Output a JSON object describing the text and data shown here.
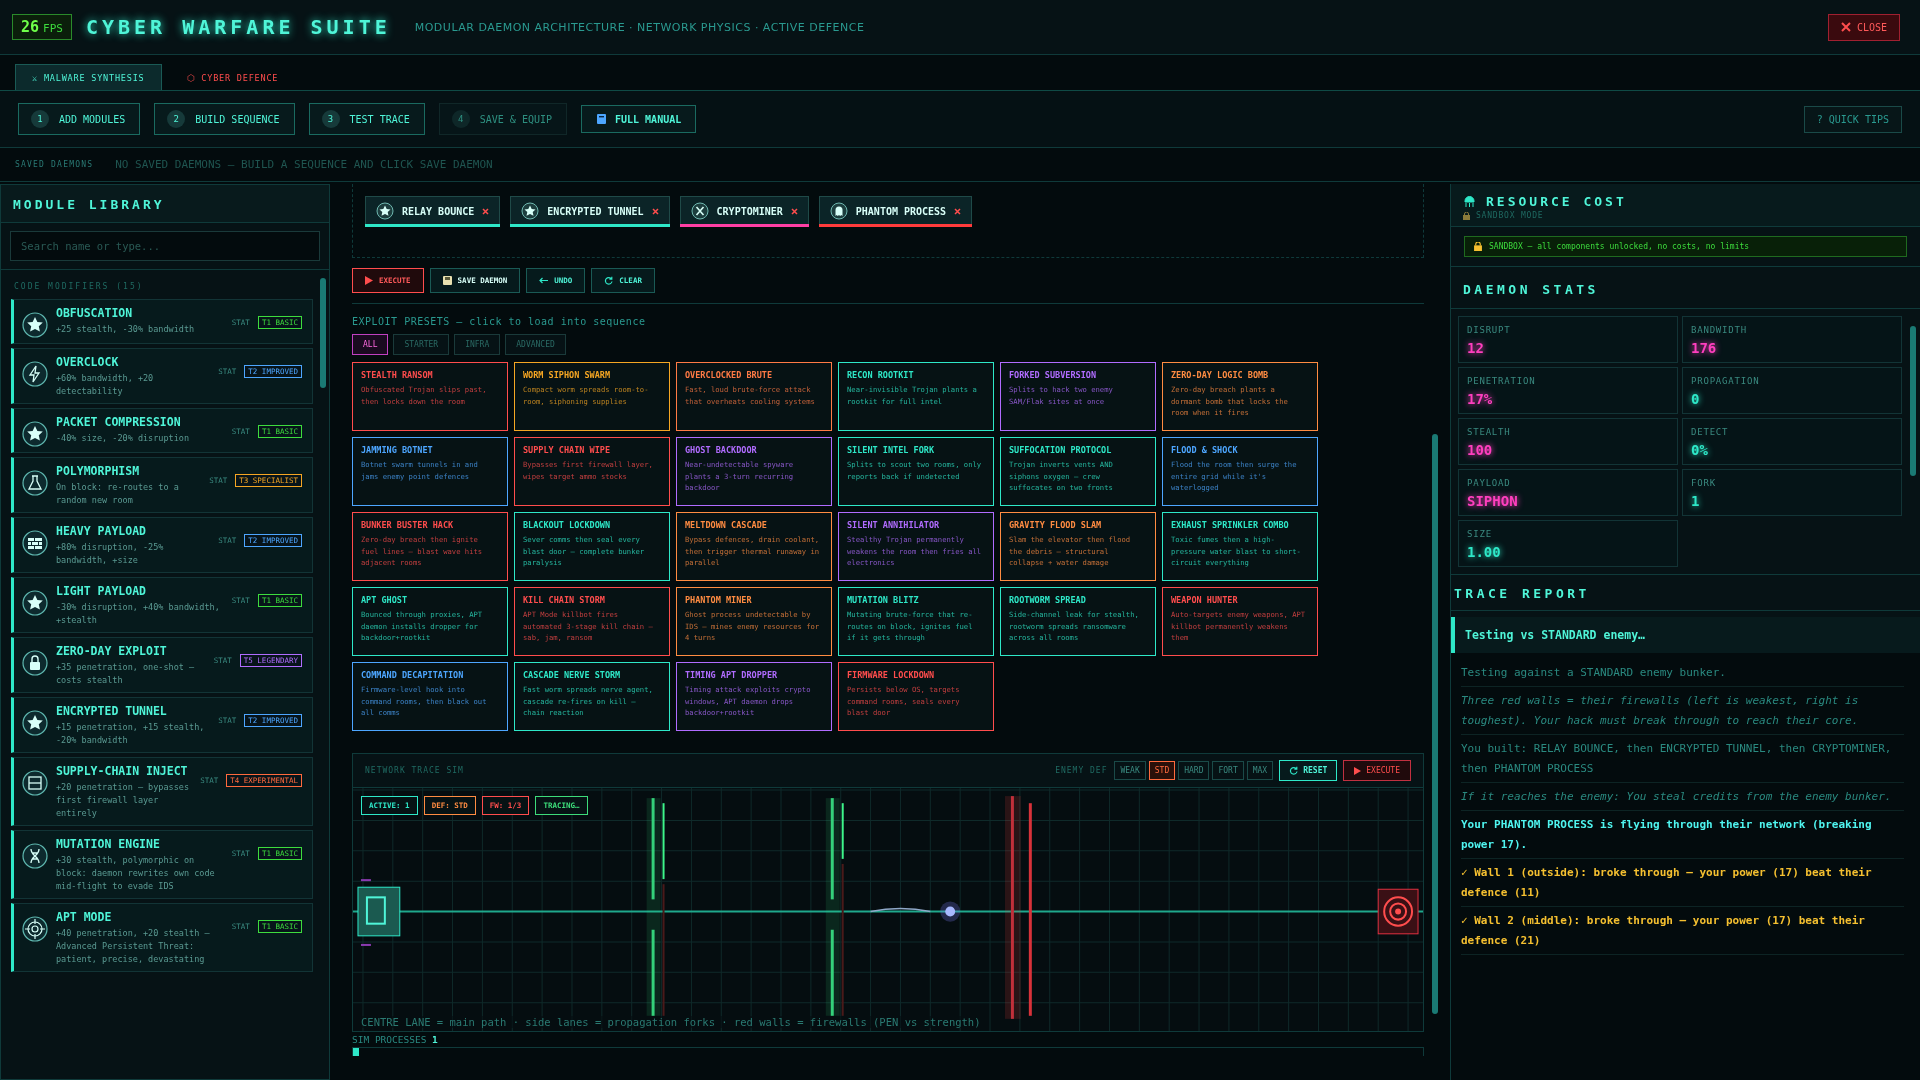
{
  "header": {
    "fps": "26",
    "fps_unit": "FPS",
    "title": "CYBER WARFARE SUITE",
    "subtitle": "MODULAR DAEMON ARCHITECTURE · NETWORK PHYSICS · ACTIVE DEFENCE",
    "close": "CLOSE"
  },
  "tabs": [
    {
      "icon": "⚔",
      "label": "MALWARE SYNTHESIS",
      "selected": true
    },
    {
      "icon": "⬡",
      "label": "CYBER DEFENCE",
      "selected": false
    }
  ],
  "steps": [
    {
      "number": "1",
      "label": "ADD MODULES",
      "disabled": false
    },
    {
      "number": "2",
      "label": "BUILD SEQUENCE",
      "disabled": false
    },
    {
      "number": "3",
      "label": "TEST TRACE",
      "disabled": false
    },
    {
      "number": "4",
      "label": "SAVE & EQUIP",
      "disabled": true
    }
  ],
  "manual": "FULL MANUAL",
  "quick_tips": "? QUICK TIPS",
  "saved_daemons": {
    "label": "SAVED DAEMONS",
    "empty": "NO SAVED DAEMONS — BUILD A SEQUENCE AND CLICK SAVE DAEMON"
  },
  "library": {
    "title": "MODULE LIBRARY",
    "search_placeholder": "Search name or type...",
    "group": "CODE MODIFIERS (15)",
    "modules": [
      {
        "kind": "star",
        "name": "OBFUSCATION",
        "desc": "+25 stealth, -30% bandwidth",
        "stat": "STAT",
        "tier": "T1 BASIC",
        "color": "#3ddc3d"
      },
      {
        "kind": "bolt",
        "name": "OVERCLOCK",
        "desc": "+60% bandwidth, +20 detectability",
        "stat": "STAT",
        "tier": "T2 IMPROVED",
        "color": "#4da6ff"
      },
      {
        "kind": "star",
        "name": "PACKET COMPRESSION",
        "desc": "-40% size, -20% disruption",
        "stat": "STAT",
        "tier": "T1 BASIC",
        "color": "#3ddc3d"
      },
      {
        "kind": "flask",
        "name": "POLYMORPHISM",
        "desc": "On block: re-routes to a random new room",
        "stat": "STAT",
        "tier": "T3 SPECIALIST",
        "color": "#f5a623"
      },
      {
        "kind": "brick",
        "name": "HEAVY PAYLOAD",
        "desc": "+80% disruption, -25% bandwidth, +size",
        "stat": "STAT",
        "tier": "T2 IMPROVED",
        "color": "#4da6ff"
      },
      {
        "kind": "star",
        "name": "LIGHT PAYLOAD",
        "desc": "-30% disruption, +40% bandwidth, +stealth",
        "stat": "STAT",
        "tier": "T1 BASIC",
        "color": "#3ddc3d"
      },
      {
        "kind": "lock",
        "name": "ZERO-DAY EXPLOIT",
        "desc": "+35 penetration, one-shot — costs stealth",
        "stat": "STAT",
        "tier": "T5 LEGENDARY",
        "color": "#b06cff"
      },
      {
        "kind": "star",
        "name": "ENCRYPTED TUNNEL",
        "desc": "+15 penetration, +15 stealth, -20% bandwidth",
        "stat": "STAT",
        "tier": "T2 IMPROVED",
        "color": "#4da6ff"
      },
      {
        "kind": "panel",
        "name": "SUPPLY-CHAIN INJECT",
        "desc": "+20 penetration — bypasses first firewall layer entirely",
        "stat": "STAT",
        "tier": "T4 EXPERIMENTAL",
        "color": "#ff6a3d"
      },
      {
        "kind": "dna",
        "name": "MUTATION ENGINE",
        "desc": "+30 stealth, polymorphic on block: daemon rewrites own code mid-flight to evade IDS",
        "stat": "STAT",
        "tier": "T1 BASIC",
        "color": "#3ddc3d"
      },
      {
        "kind": "target",
        "name": "APT MODE",
        "desc": "+40 penetration, +20 stealth — Advanced Persistent Threat: patient, precise, devastating",
        "stat": "STAT",
        "tier": "T1 BASIC",
        "color": "#3ddc3d"
      }
    ]
  },
  "sequence": {
    "chips": [
      {
        "kind": "star",
        "label": "RELAY BOUNCE",
        "color": "#2ee8c8"
      },
      {
        "kind": "star",
        "label": "ENCRYPTED TUNNEL",
        "color": "#2ee8c8"
      },
      {
        "kind": "x",
        "label": "CRYPTOMINER",
        "color": "#ff3fa4"
      },
      {
        "kind": "ghost",
        "label": "PHANTOM PROCESS",
        "color": "#ff3b3b"
      }
    ],
    "actions": [
      {
        "kind": "execute",
        "label": "EXECUTE"
      },
      {
        "kind": "save",
        "label": "SAVE DAEMON"
      },
      {
        "kind": "undo",
        "label": "UNDO"
      },
      {
        "kind": "clear",
        "label": "CLEAR"
      }
    ]
  },
  "presets": {
    "title": "EXPLOIT PRESETS — click to load into sequence",
    "filters": [
      {
        "label": "ALL",
        "selected": true
      },
      {
        "label": "STARTER",
        "selected": false
      },
      {
        "label": "INFRA",
        "selected": false
      },
      {
        "label": "ADVANCED",
        "selected": false
      }
    ],
    "cards": [
      {
        "title": "STEALTH RANSOM",
        "desc": "Obfuscated Trojan slips past, then locks down the room",
        "color": "#ff4d4d"
      },
      {
        "title": "WORM SIPHON SWARM",
        "desc": "Compact worm spreads room-to-room, siphoning supplies",
        "color": "#f5a623"
      },
      {
        "title": "OVERCLOCKED BRUTE",
        "desc": "Fast, loud brute-force attack that overheats cooling systems",
        "color": "#ff7a45"
      },
      {
        "title": "RECON ROOTKIT",
        "desc": "Near-invisible Trojan plants a rootkit for full intel",
        "color": "#2ee8c8"
      },
      {
        "title": "FORKED SUBVERSION",
        "desc": "Splits to hack two enemy SAM/Flak sites at once",
        "color": "#b06cff"
      },
      {
        "title": "ZERO-DAY LOGIC BOMB",
        "desc": "Zero-day breach plants a dormant bomb that locks the room when it fires",
        "color": "#ff8c42"
      },
      {
        "title": "JAMMING BOTNET",
        "desc": "Botnet swarm tunnels in and jams enemy point defences",
        "color": "#4da6ff"
      },
      {
        "title": "SUPPLY CHAIN WIPE",
        "desc": "Bypasses first firewall layer, wipes target ammo stocks",
        "color": "#ff4d4d"
      },
      {
        "title": "GHOST BACKDOOR",
        "desc": "Near-undetectable spyware plants a 3-turn recurring backdoor",
        "color": "#b06cff"
      },
      {
        "title": "SILENT INTEL FORK",
        "desc": "Splits to scout two rooms, only reports back if undetected",
        "color": "#2ee8c8"
      },
      {
        "title": "SUFFOCATION PROTOCOL",
        "desc": "Trojan inverts vents AND siphons oxygen — crew suffocates on two fronts",
        "color": "#2ee8c8"
      },
      {
        "title": "FLOOD & SHOCK",
        "desc": "Flood the room then surge the entire grid while it's waterlogged",
        "color": "#4da6ff"
      },
      {
        "title": "BUNKER BUSTER HACK",
        "desc": "Zero-day breach then ignite fuel lines — blast wave hits adjacent rooms",
        "color": "#ff4d4d"
      },
      {
        "title": "BLACKOUT LOCKDOWN",
        "desc": "Sever comms then seal every blast door — complete bunker paralysis",
        "color": "#2ee8c8"
      },
      {
        "title": "MELTDOWN CASCADE",
        "desc": "Bypass defences, drain coolant, then trigger thermal runaway in parallel",
        "color": "#ff8c42"
      },
      {
        "title": "SILENT ANNIHILATOR",
        "desc": "Stealthy Trojan permanently weakens the room then fries all electronics",
        "color": "#b06cff"
      },
      {
        "title": "GRAVITY FLOOD SLAM",
        "desc": "Slam the elevator then flood the debris — structural collapse + water damage",
        "color": "#ff8c42"
      },
      {
        "title": "EXHAUST SPRINKLER COMBO",
        "desc": "Toxic fumes then a high-pressure water blast to short-circuit everything",
        "color": "#2ee8c8"
      },
      {
        "title": "APT GHOST",
        "desc": "Bounced through proxies, APT daemon installs dropper for backdoor+rootkit",
        "color": "#2ee8c8"
      },
      {
        "title": "KILL CHAIN STORM",
        "desc": "APT Mode killbot fires automated 3-stage kill chain — sab, jam, ransom",
        "color": "#ff4d4d"
      },
      {
        "title": "PHANTOM MINER",
        "desc": "Ghost process undetectable by IDS — mines enemy resources for 4 turns",
        "color": "#ff8c42"
      },
      {
        "title": "MUTATION BLITZ",
        "desc": "Mutating brute-force that re-routes on block, ignites fuel if it gets through",
        "color": "#2ee8c8"
      },
      {
        "title": "ROOTWORM SPREAD",
        "desc": "Side-channel leak for stealth, rootworm spreads ransomware across all rooms",
        "color": "#2ee8c8"
      },
      {
        "title": "WEAPON HUNTER",
        "desc": "Auto-targets enemy weapons, APT killbot permanently weakens them",
        "color": "#ff4d4d"
      },
      {
        "title": "COMMAND DECAPITATION",
        "desc": "Firmware-level hook into command rooms, then black out all comms",
        "color": "#4da6ff"
      },
      {
        "title": "CASCADE NERVE STORM",
        "desc": "Fast worm spreads nerve agent, cascade re-fires on kill — chain reaction",
        "color": "#2ee8c8"
      },
      {
        "title": "TIMING APT DROPPER",
        "desc": "Timing attack exploits crypto windows, APT daemon drops backdoor+rootkit",
        "color": "#b06cff"
      },
      {
        "title": "FIRMWARE LOCKDOWN",
        "desc": "Persists below OS, targets command rooms, seals every blast door",
        "color": "#ff4d4d"
      }
    ]
  },
  "sim": {
    "title": "NETWORK TRACE SIM",
    "def_label": "ENEMY DEF",
    "levels": [
      {
        "label": "WEAK",
        "selected": false
      },
      {
        "label": "STD",
        "selected": true
      },
      {
        "label": "HARD",
        "selected": false
      },
      {
        "label": "FORT",
        "selected": false
      },
      {
        "label": "MAX",
        "selected": false
      }
    ],
    "reset": "RESET",
    "execute": "EXECUTE",
    "pills": [
      {
        "text": "ACTIVE: 1",
        "color": "#2ee8c8"
      },
      {
        "text": "DEF: STD",
        "color": "#ff8c42"
      },
      {
        "text": "FW: 1/3",
        "color": "#ff4d4d"
      },
      {
        "text": "TRACING…",
        "color": "#3ddc7a"
      }
    ],
    "legend": "CENTRE LANE = main path · side lanes = propagation forks · red walls = firewalls (PEN vs strength)",
    "processes_label": "SIM PROCESSES",
    "processes": "1",
    "level": 0.006
  },
  "resource": {
    "title": "RESOURCE COST",
    "mode": "SANDBOX MODE",
    "notice": "SANDBOX — all components unlocked, no costs, no limits"
  },
  "stats": {
    "title": "DAEMON STATS",
    "items": [
      {
        "label": "DISRUPT",
        "value": "12",
        "color": "#ff3fbf"
      },
      {
        "label": "BANDWIDTH",
        "value": "176",
        "color": "#ff3fbf"
      },
      {
        "label": "PENETRATION",
        "value": "17%",
        "color": "#ff3fbf"
      },
      {
        "label": "PROPAGATION",
        "value": "0",
        "color": "#2ee8c8"
      },
      {
        "label": "STEALTH",
        "value": "100",
        "color": "#ff3fbf"
      },
      {
        "label": "DETECT",
        "value": "0%",
        "color": "#2ee8c8"
      },
      {
        "label": "PAYLOAD",
        "value": "SIPHON",
        "color": "#ff3fbf"
      },
      {
        "label": "FORK",
        "value": "1",
        "color": "#2ee8c8"
      },
      {
        "label": "SIZE",
        "value": "1.00",
        "color": "#2ee8c8"
      }
    ]
  },
  "trace": {
    "title": "TRACE REPORT",
    "status": "Testing vs STANDARD enemy…",
    "lines": [
      {
        "kind": "plain",
        "text": "Testing against a STANDARD enemy bunker."
      },
      {
        "kind": "note",
        "text": "Three red walls = their firewalls (left is weakest, right is toughest). Your hack must break through to reach their core."
      },
      {
        "kind": "plain",
        "text": "You built: RELAY BOUNCE, then ENCRYPTED TUNNEL, then CRYPTOMINER, then PHANTOM PROCESS"
      },
      {
        "kind": "note",
        "text": "If it reaches the enemy: You steal credits from the enemy bunker."
      },
      {
        "kind": "highlight",
        "text": "Your PHANTOM PROCESS is flying through their network (breaking power 17)."
      },
      {
        "kind": "success",
        "text": "✓ Wall 1 (outside): broke through — your power (17) beat their defence (11)"
      },
      {
        "kind": "success",
        "text": "✓ Wall 2 (middle): broke through — your power (17) beat their defence (21)"
      }
    ]
  }
}
